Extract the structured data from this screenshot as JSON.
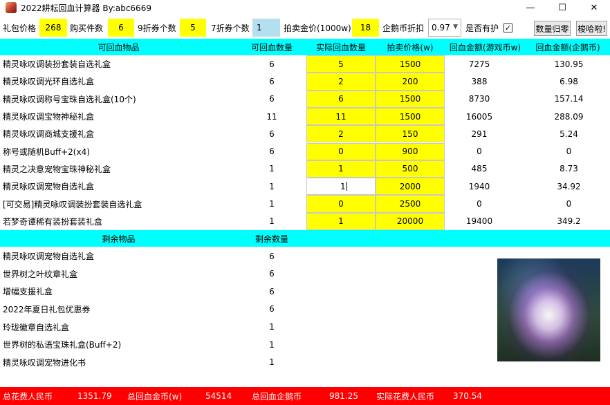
{
  "window": {
    "title": "2022耕耘回血计算器 By:abc6669",
    "minimize": "—",
    "maximize": "☐",
    "close": "✕"
  },
  "controls": {
    "gift_price_label": "礼包价格",
    "gift_price": "268",
    "buy_count_label": "购买件数",
    "buy_count": "6",
    "coupon9_label": "9折券个数",
    "coupon9": "5",
    "coupon7_label": "7折券个数",
    "coupon7": "1",
    "auction_gold_label": "拍卖金价(1000w)",
    "auction_gold": "18",
    "penguin_discount_label": "企鹅币折扣",
    "penguin_discount": "0.97",
    "protect_label": "是否有护",
    "protect_checked": true,
    "reset_button": "数量归零",
    "fun_button": "梭哈啦!"
  },
  "recover_table": {
    "headers": [
      "可回血物品",
      "可回血数量",
      "实际回血数量",
      "拍卖价格(w)",
      "回血金额(游戏币w)",
      "回血金额(企鹅币)"
    ],
    "rows": [
      {
        "name": "精灵咏叹调装扮套装自选礼盒",
        "count": "6",
        "actual": "5",
        "price": "1500",
        "gold": "7275",
        "penguin": "130.95"
      },
      {
        "name": "精灵咏叹调光环自选礼盒",
        "count": "6",
        "actual": "2",
        "price": "200",
        "gold": "388",
        "penguin": "6.98"
      },
      {
        "name": "精灵咏叹调称号宝珠自选礼盒(10个)",
        "count": "6",
        "actual": "6",
        "price": "1500",
        "gold": "8730",
        "penguin": "157.14"
      },
      {
        "name": "精灵咏叹调宝物神秘礼盒",
        "count": "11",
        "actual": "11",
        "price": "1500",
        "gold": "16005",
        "penguin": "288.09"
      },
      {
        "name": "精灵咏叹调商城支援礼盒",
        "count": "6",
        "actual": "2",
        "price": "150",
        "gold": "291",
        "penguin": "5.24"
      },
      {
        "name": "称号或随机Buff+2(x4)",
        "count": "6",
        "actual": "0",
        "price": "900",
        "gold": "0",
        "penguin": "0"
      },
      {
        "name": "精灵之决意宠物宝珠神秘礼盒",
        "count": "1",
        "actual": "1",
        "price": "500",
        "gold": "485",
        "penguin": "8.73"
      },
      {
        "name": "精灵咏叹调宠物自选礼盒",
        "count": "1",
        "actual": "1",
        "price": "2000",
        "gold": "1940",
        "penguin": "34.92"
      },
      {
        "name": "[可交易]精灵咏叹调装扮套装自选礼盒",
        "count": "1",
        "actual": "0",
        "price": "2500",
        "gold": "0",
        "penguin": "0"
      },
      {
        "name": "若梦奇谭稀有装扮套装礼盒",
        "count": "1",
        "actual": "1",
        "price": "20000",
        "gold": "19400",
        "penguin": "349.2"
      }
    ]
  },
  "remaining_table": {
    "headers": [
      "剩余物品",
      "剩余数量"
    ],
    "rows": [
      {
        "name": "精灵咏叹调宠物自选礼盒",
        "count": "6"
      },
      {
        "name": "世界树之叶纹章礼盒",
        "count": "6"
      },
      {
        "name": "增幅支援礼盒",
        "count": "6"
      },
      {
        "name": "2022年夏日礼包优惠券",
        "count": "6"
      },
      {
        "name": "玲珑徽章自选礼盒",
        "count": "1"
      },
      {
        "name": "世界树的私语宝珠礼盒(Buff+2)",
        "count": "1"
      },
      {
        "name": "精灵咏叹调宠物进化书",
        "count": "1"
      }
    ]
  },
  "footer": {
    "total_rmb_label": "总花费人民币",
    "total_rmb": "1351.79",
    "total_gold_label": "总回血金币(w)",
    "total_gold": "54514",
    "total_penguin_label": "总回血企鹅币",
    "total_penguin": "981.25",
    "actual_rmb_label": "实际花费人民币",
    "actual_rmb": "370.54"
  }
}
